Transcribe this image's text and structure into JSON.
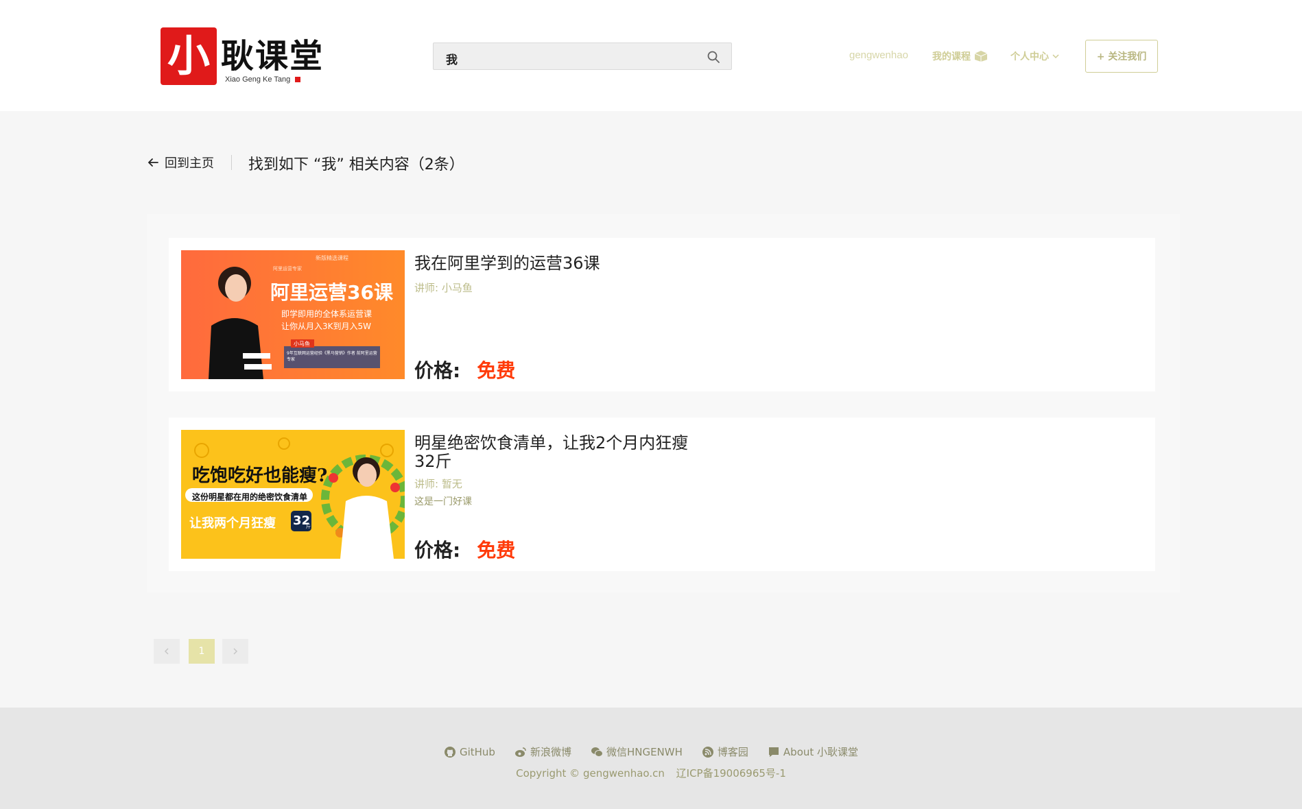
{
  "header": {
    "logo": {
      "seal_char": "小",
      "title": "耿课堂",
      "subtitle": "Xiao Geng Ke Tang"
    },
    "search": {
      "value": "我",
      "icon": "search-icon"
    },
    "nav": {
      "username": "gengwenhao",
      "my_courses": "我的课程",
      "personal_center": "个人中心",
      "follow_us": "+ 关注我们"
    }
  },
  "breadcrumb": {
    "back_label": "回到主页",
    "result_title": "找到如下 “我” 相关内容（2条）"
  },
  "results": [
    {
      "title": "我在阿里学到的运营36课",
      "teacher": "讲师: 小马鱼",
      "description": "",
      "price_label": "价格:",
      "price_value": "免费",
      "thumbnail": {
        "top_label": "新版精选课程",
        "side_label": "阿里运营专家",
        "headline": "阿里运营36课",
        "line1": "即学即用的全体系运营课",
        "line2": "让你从月入3K到月入5W",
        "name_tag": "小马鱼",
        "bio": "9年互联网运营经验《黑马营销》作者 前阿里运营专家"
      }
    },
    {
      "title": "明星绝密饮食清单，让我2个月内狂瘦32斤",
      "teacher": "讲师: 暂无",
      "description": "这是一门好课",
      "price_label": "价格:",
      "price_value": "免费",
      "thumbnail": {
        "headline": "吃饱吃好也能瘦?",
        "line1": "这份明星都在用的绝密饮食清单",
        "line2": "让我两个月狂瘦",
        "badge": "32",
        "badge_unit": "斤"
      }
    }
  ],
  "pagination": {
    "prev_icon": "chevron-left-icon",
    "current_page": "1",
    "next_icon": "chevron-right-icon"
  },
  "footer": {
    "links": [
      {
        "label": "GitHub",
        "icon": "github-icon"
      },
      {
        "label": "新浪微博",
        "icon": "weibo-icon"
      },
      {
        "label": "微信HNGENWH",
        "icon": "wechat-icon"
      },
      {
        "label": "博客园",
        "icon": "blog-icon"
      },
      {
        "label": "About 小耿课堂",
        "icon": "about-icon"
      }
    ],
    "copyright": "Copyright © gengwenhao.cn",
    "icp": "辽ICP备19006965号-1"
  },
  "colors": {
    "accent": "#cfcd96",
    "price": "#ff3b0a",
    "logo_red": "#e01a1a"
  }
}
